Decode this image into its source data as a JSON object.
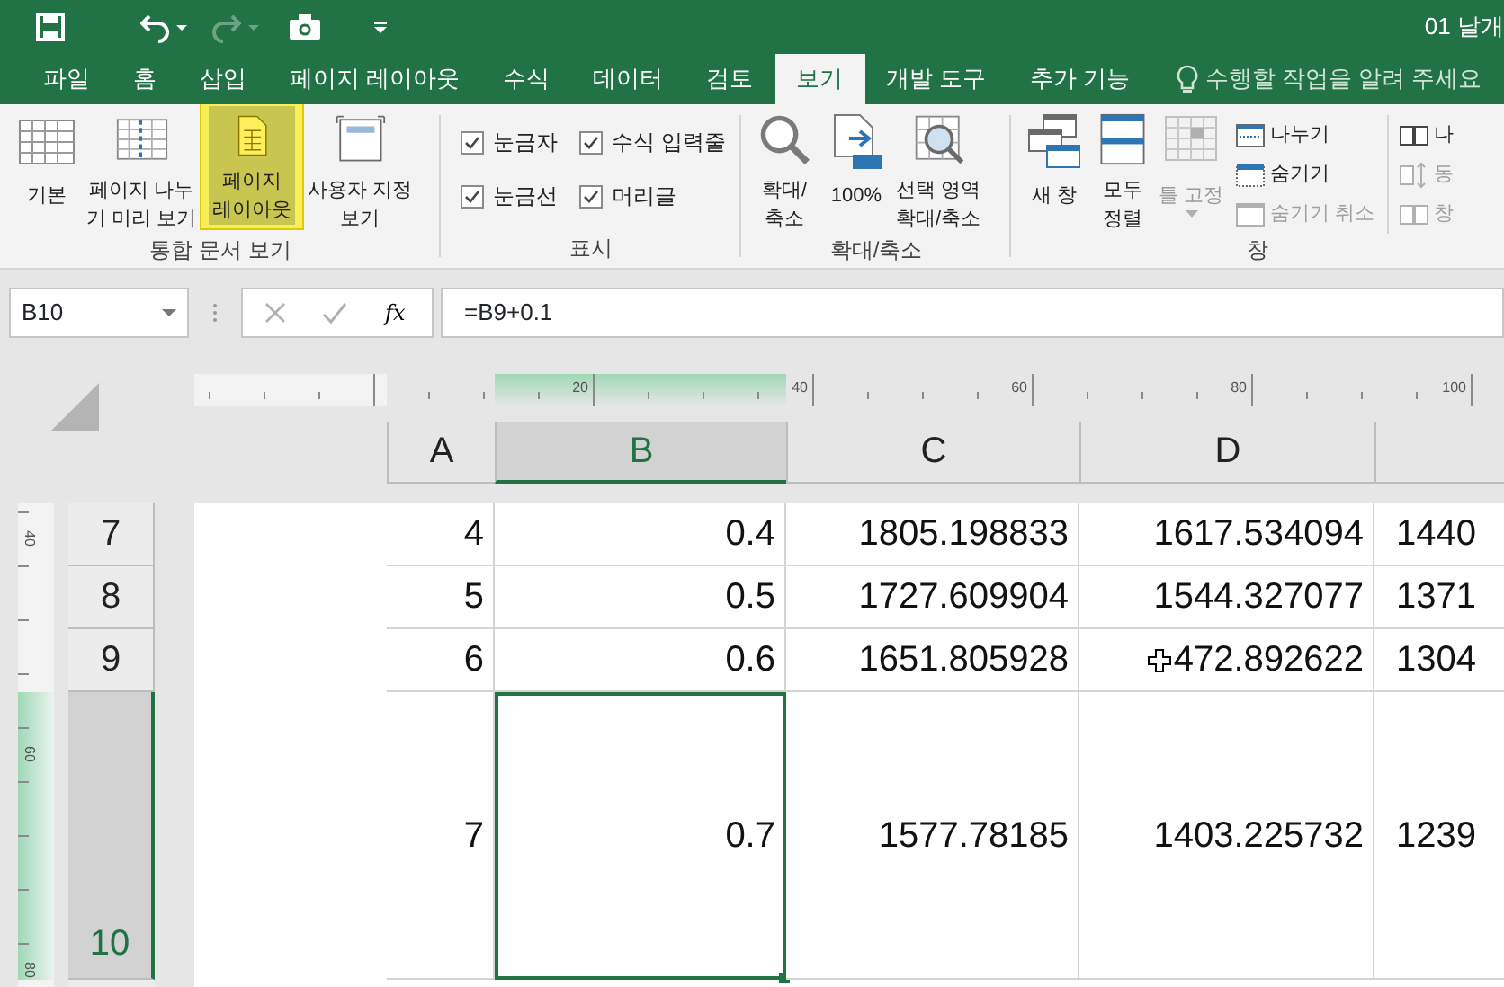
{
  "window": {
    "title": "01 날개"
  },
  "tabs": [
    {
      "label": "파일",
      "selected": false
    },
    {
      "label": "홈",
      "selected": false
    },
    {
      "label": "삽입",
      "selected": false
    },
    {
      "label": "페이지 레이아웃",
      "selected": false
    },
    {
      "label": "수식",
      "selected": false
    },
    {
      "label": "데이터",
      "selected": false
    },
    {
      "label": "검토",
      "selected": false
    },
    {
      "label": "보기",
      "selected": true
    },
    {
      "label": "개발 도구",
      "selected": false
    },
    {
      "label": "추가 기능",
      "selected": false
    }
  ],
  "tell_me": {
    "placeholder": "수행할 작업을 알려 주세요"
  },
  "ribbon": {
    "groups": [
      {
        "label": "통합 문서 보기",
        "items": [
          {
            "kind": "large",
            "lines": [
              "기본"
            ],
            "selected": false,
            "disabled": false
          },
          {
            "kind": "large",
            "lines": [
              "페이지 나누",
              "기 미리 보기"
            ],
            "selected": false,
            "disabled": false
          },
          {
            "kind": "large",
            "lines": [
              "페이지",
              "레이아웃"
            ],
            "selected": true,
            "disabled": false
          },
          {
            "kind": "large",
            "lines": [
              "사용자 지정",
              "보기"
            ],
            "selected": false,
            "disabled": false
          }
        ]
      },
      {
        "label": "표시",
        "items": [
          {
            "kind": "stack",
            "entries": [
              {
                "kind": "checkbox",
                "label": "눈금자",
                "checked": true
              },
              {
                "kind": "checkbox",
                "label": "눈금선",
                "checked": true
              }
            ]
          },
          {
            "kind": "stack",
            "entries": [
              {
                "kind": "checkbox",
                "label": "수식 입력줄",
                "checked": true
              },
              {
                "kind": "checkbox",
                "label": "머리글",
                "checked": true
              }
            ]
          }
        ]
      },
      {
        "label": "확대/축소",
        "items": [
          {
            "kind": "large",
            "lines": [
              "확대/",
              "축소"
            ],
            "selected": false,
            "disabled": false
          },
          {
            "kind": "large",
            "lines": [
              "100%"
            ],
            "selected": false,
            "disabled": false
          },
          {
            "kind": "large",
            "lines": [
              "선택 영역",
              "확대/축소"
            ],
            "selected": false,
            "disabled": false
          }
        ]
      },
      {
        "label": "창",
        "items": [
          {
            "kind": "large",
            "lines": [
              "새 창"
            ],
            "selected": false,
            "disabled": false
          },
          {
            "kind": "large",
            "lines": [
              "모두",
              "정렬"
            ],
            "selected": false,
            "disabled": false
          },
          {
            "kind": "large",
            "lines": [
              "틀 고정"
            ],
            "selected": false,
            "disabled": true
          },
          {
            "kind": "stack",
            "entries": [
              {
                "kind": "small",
                "label": "나누기",
                "disabled": false
              },
              {
                "kind": "small",
                "label": "숨기기",
                "disabled": false
              },
              {
                "kind": "small",
                "label": "숨기기 취소",
                "disabled": true
              }
            ]
          },
          {
            "kind": "stack",
            "entries": [
              {
                "kind": "small",
                "label": "나",
                "disabled": false
              },
              {
                "kind": "small",
                "label": "동",
                "disabled": true
              },
              {
                "kind": "small",
                "label": "창",
                "disabled": true
              }
            ]
          }
        ]
      }
    ]
  },
  "formula_bar": {
    "name_box": "B10",
    "function_label": "fx",
    "formula": "=B9+0.1"
  },
  "rulers": {
    "top_labels": [
      "20",
      "40",
      "60",
      "80",
      "100"
    ],
    "left_labels": [
      "40",
      "60",
      "80"
    ]
  },
  "sheet": {
    "columns": [
      {
        "label": "A",
        "selected": false
      },
      {
        "label": "B",
        "selected": true
      },
      {
        "label": "C",
        "selected": false
      },
      {
        "label": "D",
        "selected": false
      }
    ],
    "rows": [
      {
        "header": "7",
        "selected": false,
        "cells": [
          {
            "text": "4",
            "pointer": false
          },
          {
            "text": "0.4",
            "pointer": false
          },
          {
            "text": "1805.198833",
            "pointer": false
          },
          {
            "text": "1617.534094",
            "pointer": false
          },
          {
            "text": "1440",
            "pointer": false
          }
        ]
      },
      {
        "header": "8",
        "selected": false,
        "cells": [
          {
            "text": "5",
            "pointer": false
          },
          {
            "text": "0.5",
            "pointer": false
          },
          {
            "text": "1727.609904",
            "pointer": false
          },
          {
            "text": "1544.327077",
            "pointer": false
          },
          {
            "text": "1371",
            "pointer": false
          }
        ]
      },
      {
        "header": "9",
        "selected": false,
        "cells": [
          {
            "text": "6",
            "pointer": false
          },
          {
            "text": "0.6",
            "pointer": false
          },
          {
            "text": "1651.805928",
            "pointer": false
          },
          {
            "text": "472.892622",
            "pointer": true
          },
          {
            "text": "1304",
            "pointer": false
          }
        ]
      },
      {
        "header": "10",
        "selected": true,
        "cells": [
          {
            "text": "7",
            "pointer": false
          },
          {
            "text": "0.7",
            "pointer": false
          },
          {
            "text": "1577.78185",
            "pointer": false
          },
          {
            "text": "1403.225732",
            "pointer": false
          },
          {
            "text": "1239",
            "pointer": false
          }
        ]
      }
    ]
  }
}
